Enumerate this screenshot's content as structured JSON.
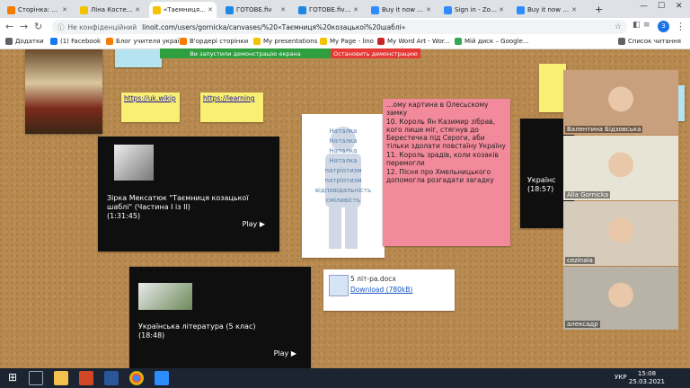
{
  "browser": {
    "tabs": [
      {
        "title": "Сторінка: ред",
        "color": "#f57c00"
      },
      {
        "title": "Ліна Костенко",
        "color": "#f5c200"
      },
      {
        "title": "«Таємниця ко",
        "color": "#f5c200",
        "active": true
      },
      {
        "title": "ГОТОВЕ.fiv",
        "color": "#1e88e5"
      },
      {
        "title": "ГОТОВЕ.fiv - G",
        "color": "#1e88e5"
      },
      {
        "title": "Buy it now - Z",
        "color": "#2d8cff"
      },
      {
        "title": "Sign in - Zoom",
        "color": "#2d8cff"
      },
      {
        "title": "Buy it now - Z",
        "color": "#2d8cff"
      }
    ],
    "security_label": "Не конфіденційний",
    "url": "linoit.com/users/gornicka/canvases/%20«Таємниця%20козацької%20шаблі»",
    "profile_initial": "З",
    "bookmarks": [
      {
        "label": "Додатки",
        "color": "#5f6368"
      },
      {
        "label": "(1) Facebook",
        "color": "#1877f2"
      },
      {
        "label": "Блог учителя украї...",
        "color": "#f57c00"
      },
      {
        "label": "В'ордері сторінки",
        "color": "#f57c00"
      },
      {
        "label": "My presentations",
        "color": "#f5c200"
      },
      {
        "label": "My Page - lino",
        "color": "#f5c200"
      },
      {
        "label": "My Word Art - Wor...",
        "color": "#c62828"
      },
      {
        "label": "Мій диск – Google...",
        "color": "#34a853"
      },
      {
        "label": "Список читання",
        "color": "#5f6368"
      }
    ]
  },
  "demo_banner": {
    "message": "Ви запустили демонстрацію екрана",
    "stop_label": "Остановить демонстрацию"
  },
  "board": {
    "link1": "https://uk.wikip",
    "link2": "https://learning",
    "video1": {
      "title": "Зірка Мексатюк \"Таємниця козацької шаблі\" (Частина I із II)",
      "duration": "(1:31:45)",
      "play": "Play"
    },
    "video2": {
      "title": "Українська література (5 клас)",
      "duration": "(18:48)",
      "play": "Play"
    },
    "video3": {
      "title": "Українс",
      "duration": "(18:57)"
    },
    "pink_lines": [
      "…ому картина в Олесьскому замку",
      "10. Король Ян Казимир зібрав, кого лише міг, стягнув до Берестечка під Сероги, аби тільки здолати повстаїну Україну",
      "11. Король зрадів, коли козаків перемогли",
      "12. Пісня про Хмельницького допомогла розгадати загадку"
    ],
    "wordcloud_words": [
      "Наталка",
      "Наталка",
      "Наталка",
      "Наталка",
      "патріотизм",
      "патріотизм",
      "відповідальність",
      "сміливість"
    ],
    "docx": {
      "filename": "5 літ-ра.docx",
      "download": "Download (780kB)"
    }
  },
  "zoom": {
    "participants": [
      {
        "name": "Валентина Бідзовська",
        "bg": "#c9a07e"
      },
      {
        "name": "Alla Gornicka",
        "bg": "#e7e3d5"
      },
      {
        "name": "cezinaia",
        "bg": "#d7cbbb"
      },
      {
        "name": "алексадр",
        "bg": "#b9b2a6"
      }
    ]
  },
  "taskbar": {
    "time": "15:08",
    "date": "25.03.2021",
    "lang": "УКР"
  }
}
